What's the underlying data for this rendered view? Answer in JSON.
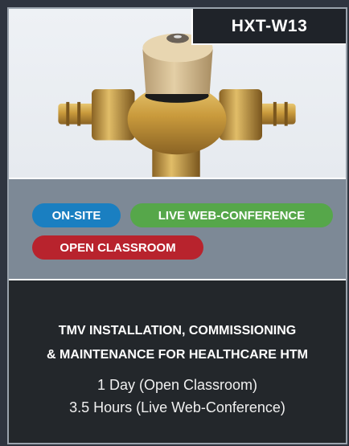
{
  "course": {
    "code": "HXT-W13",
    "title_line1": "TMV INSTALLATION, COMMISSIONING",
    "title_line2": "& MAINTENANCE FOR HEALTHCARE HTM",
    "duration_classroom": "1 Day (Open Classroom)",
    "duration_web": "3.5 Hours (Live Web-Conference)"
  },
  "tags": {
    "onsite": "ON-SITE",
    "live": "LIVE WEB-CONFERENCE",
    "classroom": "OPEN CLASSROOM"
  },
  "colors": {
    "onsite": "#1a7fc1",
    "live": "#56a74a",
    "classroom": "#b8232d",
    "tag_band": "#7d8996",
    "card_bg": "#23272b"
  },
  "image": {
    "icon": "thermostatic-mixing-valve-icon"
  }
}
